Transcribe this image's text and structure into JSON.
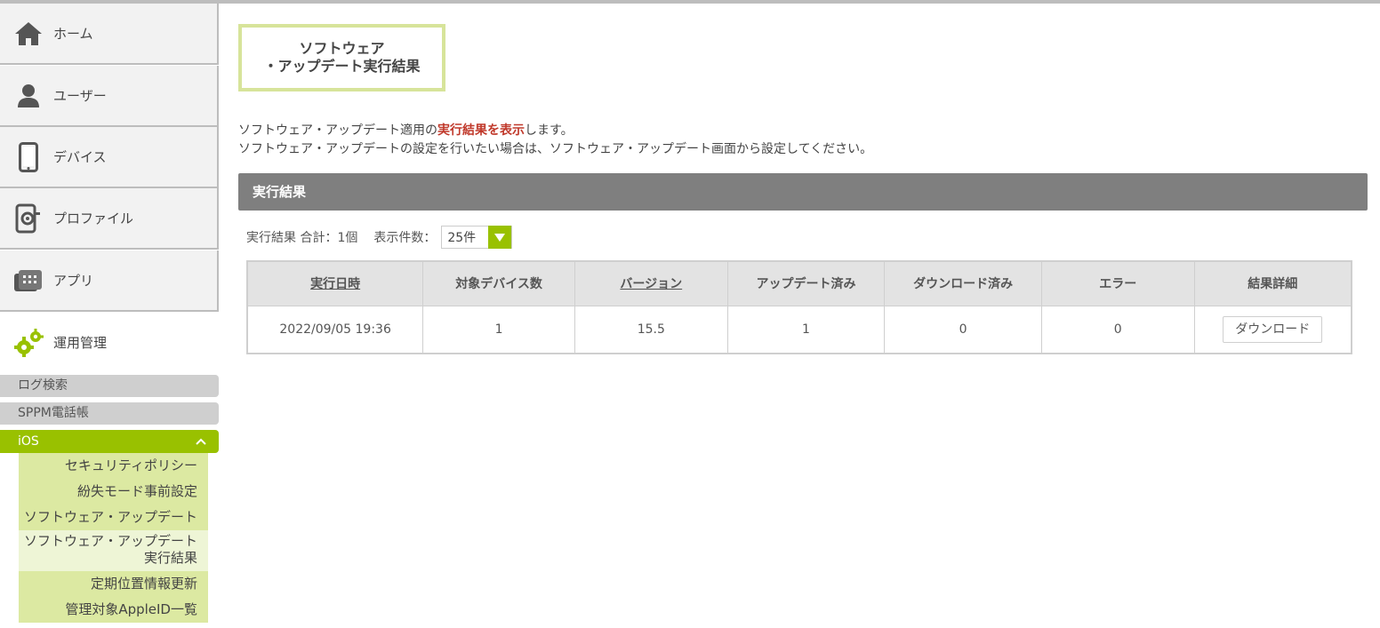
{
  "sidebar": {
    "items": [
      {
        "label": "ホーム",
        "icon": "home-icon"
      },
      {
        "label": "ユーザー",
        "icon": "user-icon"
      },
      {
        "label": "デバイス",
        "icon": "device-icon"
      },
      {
        "label": "プロファイル",
        "icon": "profile-icon"
      },
      {
        "label": "アプリ",
        "icon": "app-icon"
      },
      {
        "label": "運用管理",
        "icon": "gear-icon"
      }
    ],
    "sub": {
      "log_search": "ログ検索",
      "sppm_phonebook": "SPPM電話帳",
      "ios": "iOS"
    },
    "ios_items": [
      "セキュリティポリシー",
      "紛失モード事前設定",
      "ソフトウェア・アップデート",
      "ソフトウェア・アップデート",
      "実行結果",
      "定期位置情報更新",
      "管理対象AppleID一覧"
    ]
  },
  "page": {
    "title_line1": "ソフトウェア",
    "title_line2": "・アップデート実行結果",
    "desc_pre": "ソフトウェア・アップデート適用の",
    "desc_highlight": "実行結果を表示",
    "desc_post": "します。",
    "desc_line2": "ソフトウェア・アップデートの設定を行いたい場合は、ソフトウェア・アップデート画面から設定してください。"
  },
  "section": {
    "title": "実行結果"
  },
  "summary": {
    "total": "実行結果 合計：1個",
    "per_page_label": "表示件数：",
    "per_page_value": "25件"
  },
  "table": {
    "headers": [
      "実行日時",
      "対象デバイス数",
      "バージョン",
      "アップデート済み",
      "ダウンロード済み",
      "エラー",
      "結果詳細"
    ],
    "rows": [
      {
        "datetime": "2022/09/05 19:36",
        "devices": "1",
        "version": "15.5",
        "updated": "1",
        "downloaded": "0",
        "errors": "0",
        "action": "ダウンロード"
      }
    ]
  },
  "colors": {
    "accent": "#99c100",
    "highlight": "#c0392b",
    "section_bar": "#7f7f7f"
  }
}
